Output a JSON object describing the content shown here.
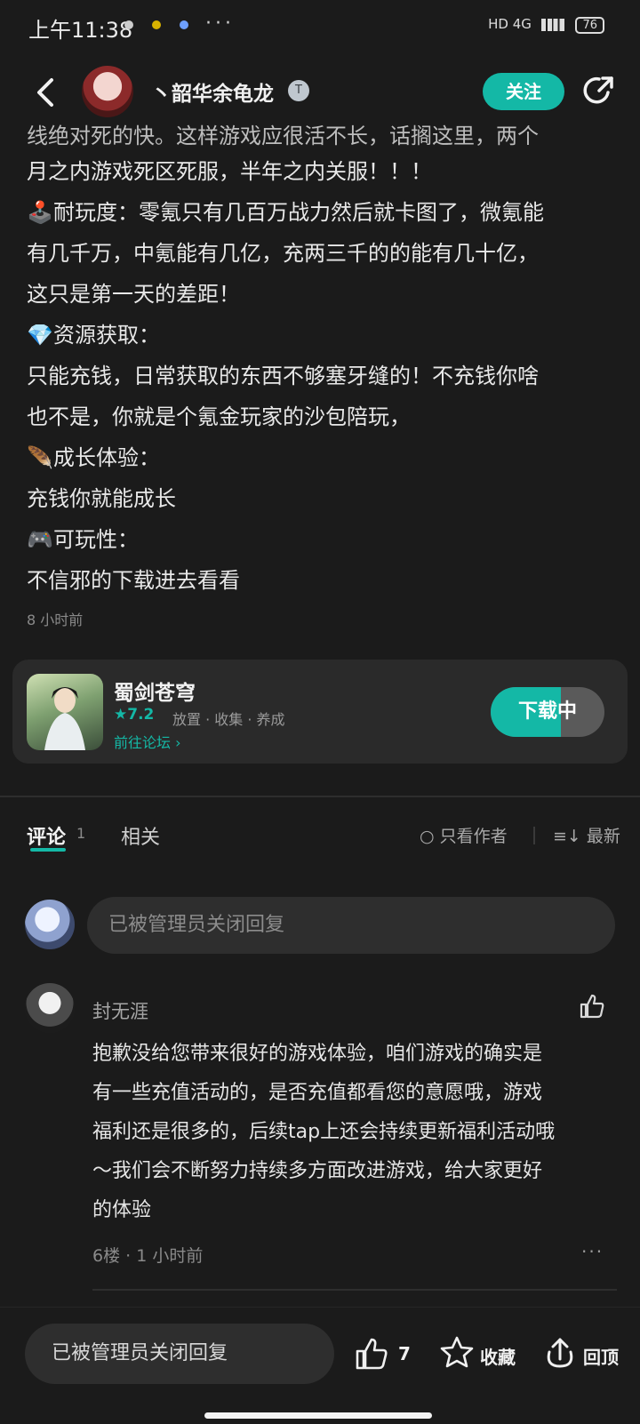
{
  "status_bar": {
    "time": "上午11:38",
    "more": "···",
    "signal": "HD 4G",
    "battery": "76"
  },
  "header": {
    "username": "丶韶华余龟龙",
    "badge": "T",
    "follow_label": "关注"
  },
  "post": {
    "clipped_line": "线绝对死的快。这样游戏应很活不长，话搁这里，两个",
    "lines": [
      {
        "icon": "",
        "text": "月之内游戏死区死服，半年之内关服！！！"
      },
      {
        "icon": "🕹️",
        "text": "耐玩度：零氪只有几百万战力然后就卡图了，微氪能"
      },
      {
        "icon": "",
        "text": "有几千万，中氪能有几亿，充两三千的的能有几十亿，"
      },
      {
        "icon": "",
        "text": "这只是第一天的差距！"
      },
      {
        "icon": "💎",
        "text": "资源获取："
      },
      {
        "icon": "",
        "text": "只能充钱，日常获取的东西不够塞牙缝的！不充钱你啥"
      },
      {
        "icon": "",
        "text": "也不是，你就是个氪金玩家的沙包陪玩，"
      },
      {
        "icon": "🪶",
        "text": "成长体验："
      },
      {
        "icon": "",
        "text": "充钱你就能成长"
      },
      {
        "icon": "🎮",
        "text": "可玩性："
      },
      {
        "icon": "",
        "text": "不信邪的下载进去看看"
      }
    ],
    "time_ago": "8 小时前"
  },
  "game_card": {
    "title": "蜀剑苍穹",
    "rating": "★7.2",
    "tags": "放置 · 收集 · 养成",
    "forum_link": "前往论坛 ›",
    "download_label": "下载中",
    "download_progress": 0.62
  },
  "tabs": {
    "comments_label": "评论",
    "comments_count": "1",
    "related_label": "相关",
    "author_only": "○ 只看作者",
    "sort_label": "≡↓ 最新"
  },
  "reply_box": {
    "placeholder": "已被管理员关闭回复"
  },
  "comment": {
    "author": "封无涯",
    "text_lines": [
      "抱歉没给您带来很好的游戏体验，咱们游戏的确实是",
      "有一些充值活动的，是否充值都看您的意愿哦，游戏",
      "福利还是很多的，后续tap上还会持续更新福利活动哦",
      "～我们会不断努力持续多方面改进游戏，给大家更好",
      "的体验"
    ],
    "meta": "6楼 · 1 小时前",
    "more": "···"
  },
  "bottom_bar": {
    "input_placeholder": "已被管理员关闭回复",
    "like_count": "7",
    "favorite_label": "收藏",
    "top_label": "回顶"
  },
  "colors": {
    "accent": "#14b8a6",
    "background": "#1b1b1b"
  }
}
